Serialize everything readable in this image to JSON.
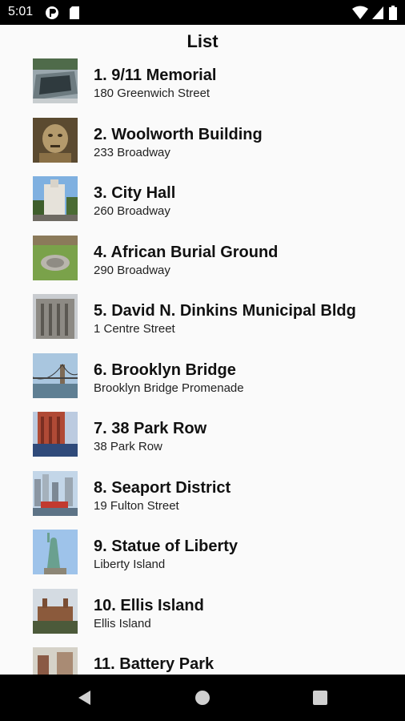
{
  "status_bar": {
    "time": "5:01",
    "left_icons": [
      "nav-app-icon",
      "sd-card-icon"
    ],
    "right_icons": [
      "wifi-icon",
      "signal-icon",
      "battery-icon"
    ]
  },
  "header": {
    "title": "List"
  },
  "items": [
    {
      "name": "1. 9/11 Memorial",
      "address": "180 Greenwich Street"
    },
    {
      "name": "2. Woolworth Building",
      "address": "233 Broadway"
    },
    {
      "name": "3. City Hall",
      "address": "260 Broadway"
    },
    {
      "name": "4. African Burial Ground",
      "address": "290 Broadway"
    },
    {
      "name": "5. David N. Dinkins Municipal Bldg",
      "address": "1 Centre Street"
    },
    {
      "name": "6. Brooklyn Bridge",
      "address": "Brooklyn Bridge Promenade"
    },
    {
      "name": "7. 38 Park Row",
      "address": "38 Park Row"
    },
    {
      "name": "8. Seaport District",
      "address": "19 Fulton Street"
    },
    {
      "name": "9. Statue of Liberty",
      "address": "Liberty Island"
    },
    {
      "name": "10. Ellis Island",
      "address": "Ellis Island"
    },
    {
      "name": "11. Battery Park",
      "address": ""
    }
  ],
  "nav_bar": {
    "buttons": [
      "back-icon",
      "home-icon",
      "recents-icon"
    ]
  }
}
